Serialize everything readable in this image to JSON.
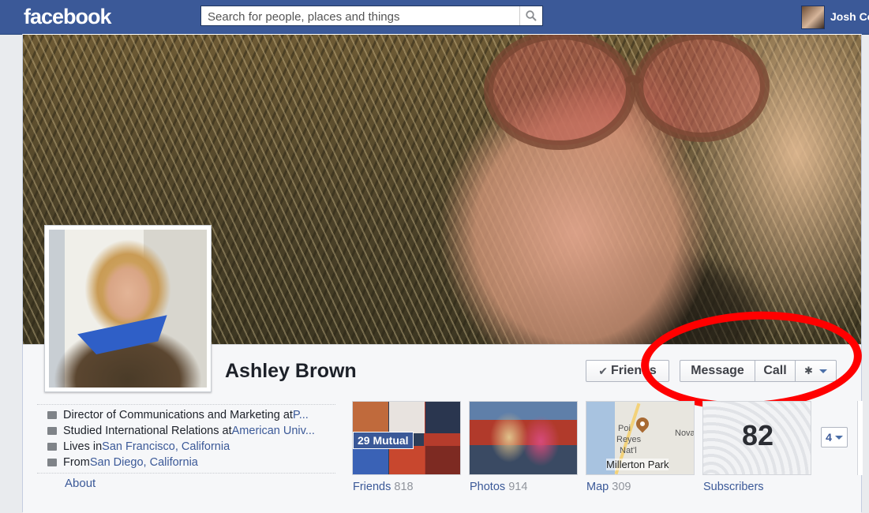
{
  "header": {
    "logo": "facebook",
    "search_placeholder": "Search for people, places and things",
    "user_name": "Josh Co"
  },
  "profile": {
    "name": "Ashley Brown",
    "buttons": {
      "friends": "Friends",
      "message": "Message",
      "call": "Call"
    },
    "facts": [
      {
        "icon": "work-icon",
        "text": "Director of Communications and Marketing at ",
        "link": "P..."
      },
      {
        "icon": "education-icon",
        "text": "Studied International Relations at ",
        "link": "American Univ..."
      },
      {
        "icon": "home-icon",
        "text": "Lives in ",
        "link": "San Francisco, California"
      },
      {
        "icon": "hometown-icon",
        "text": "From ",
        "link": "San Diego, California"
      }
    ],
    "about_link": "About"
  },
  "tiles": {
    "friends": {
      "label": "Friends",
      "count": "818",
      "badge": "29 Mutual"
    },
    "photos": {
      "label": "Photos",
      "count": "914"
    },
    "map": {
      "label": "Map",
      "count": "309",
      "place": "Millerton Park",
      "labels": [
        "Poi",
        "Reyes",
        "Nat'l",
        "Nova"
      ]
    },
    "subscribers": {
      "label": "Subscribers",
      "number": "82"
    },
    "more": {
      "label": "4"
    }
  },
  "colors": {
    "brand": "#3b5998",
    "annotation": "#ff0000"
  }
}
